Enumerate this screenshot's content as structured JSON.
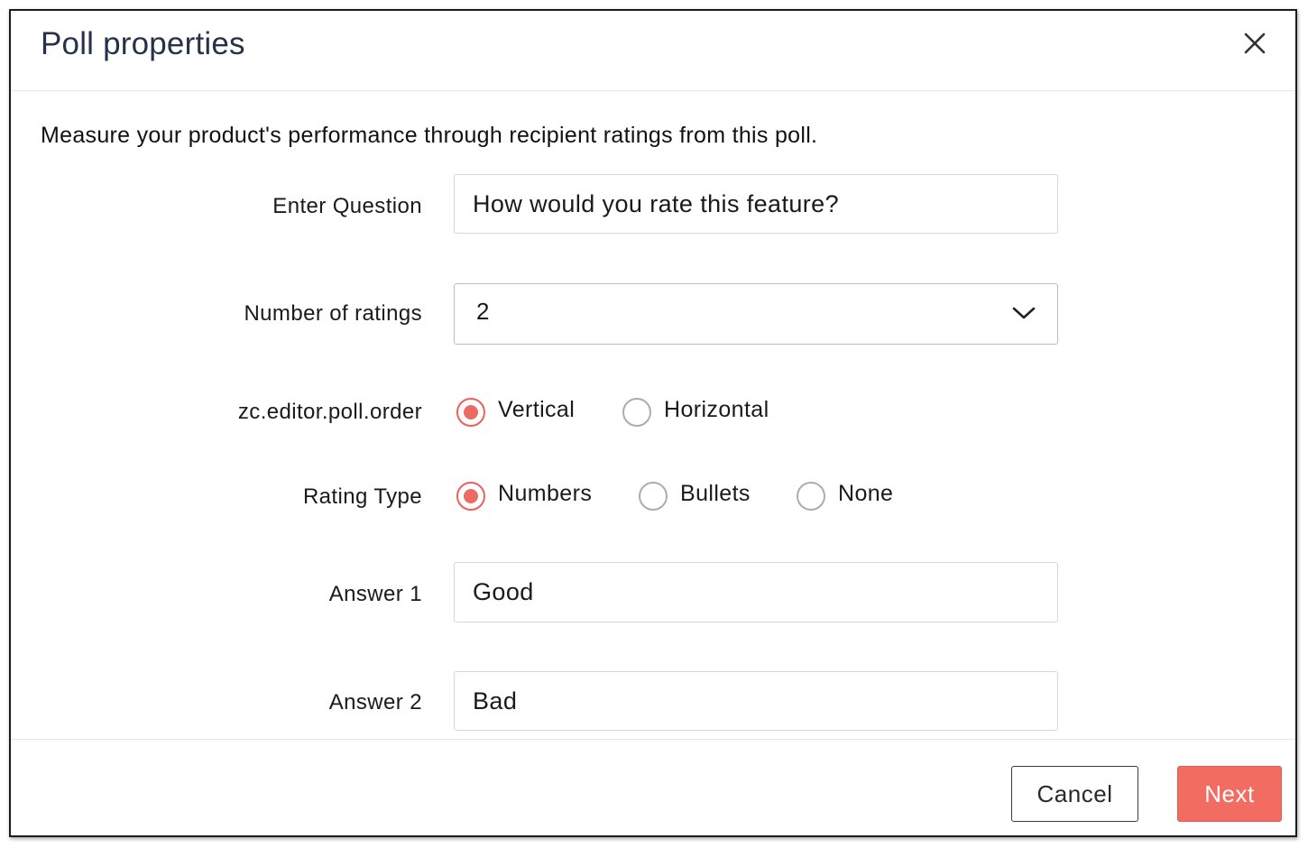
{
  "dialog": {
    "title": "Poll properties",
    "close_icon": "close-icon",
    "description": "Measure your product's performance through recipient ratings from this poll."
  },
  "form": {
    "question": {
      "label": "Enter Question",
      "value": "How would you rate this feature?"
    },
    "ratings": {
      "label": "Number of ratings",
      "selected": "2",
      "icon": "chevron-down-icon"
    },
    "order": {
      "label": "zc.editor.poll.order",
      "options": [
        {
          "label": "Vertical",
          "checked": true
        },
        {
          "label": "Horizontal",
          "checked": false
        }
      ]
    },
    "rating_type": {
      "label": "Rating Type",
      "options": [
        {
          "label": "Numbers",
          "checked": true
        },
        {
          "label": "Bullets",
          "checked": false
        },
        {
          "label": "None",
          "checked": false
        }
      ]
    },
    "answers": [
      {
        "label": "Answer 1",
        "value": "Good"
      },
      {
        "label": "Answer 2",
        "value": "Bad"
      }
    ]
  },
  "footer": {
    "cancel_label": "Cancel",
    "next_label": "Next"
  },
  "colors": {
    "accent": "#f36c62",
    "title": "#26324a",
    "radio_checked": "#ec6b62"
  }
}
